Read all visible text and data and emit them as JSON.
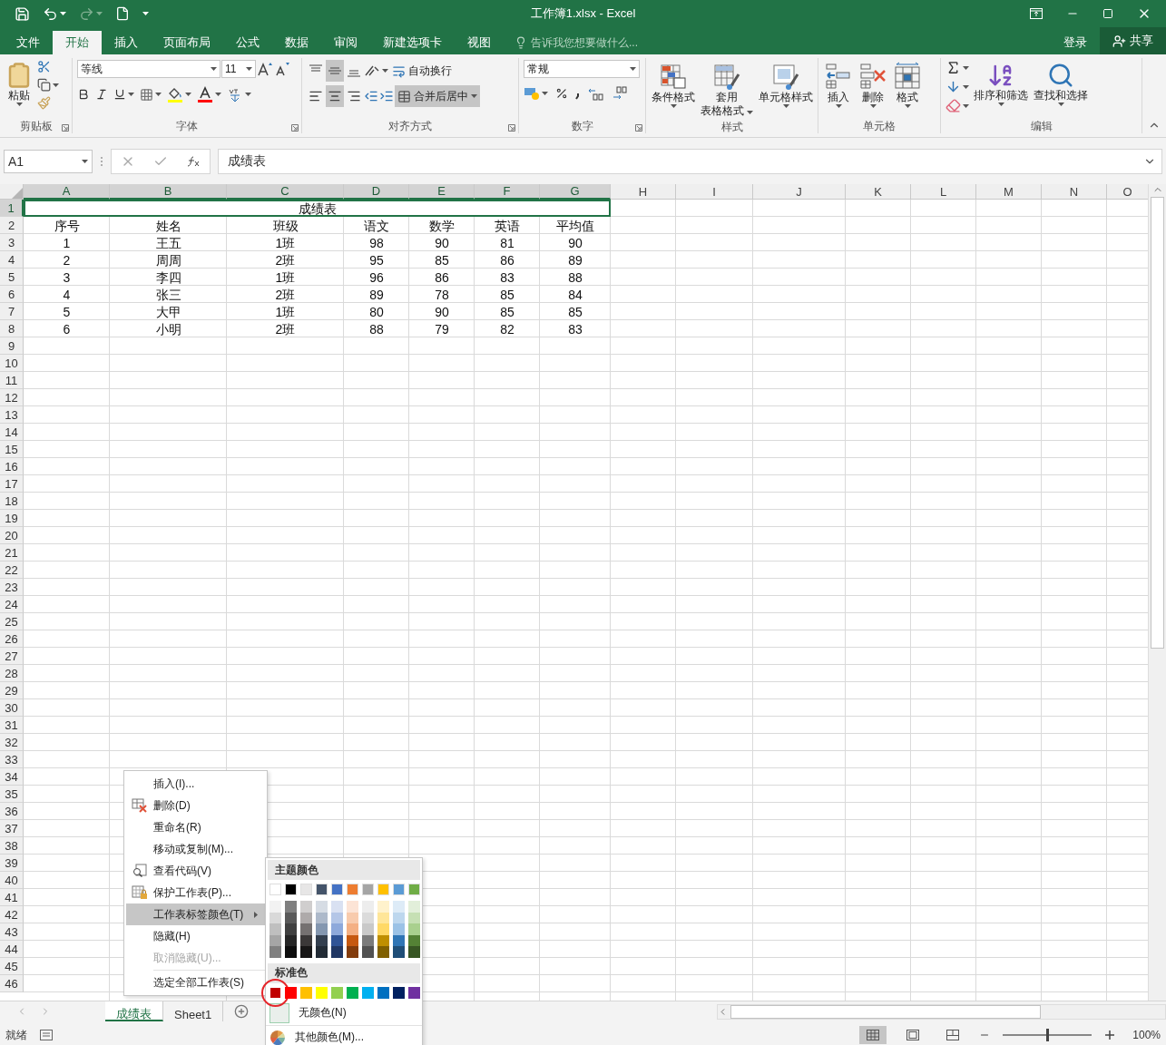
{
  "window": {
    "title": "工作簿1.xlsx - Excel"
  },
  "menu_tabs": [
    {
      "label": "文件",
      "selected": false
    },
    {
      "label": "开始",
      "selected": true
    },
    {
      "label": "插入",
      "selected": false
    },
    {
      "label": "页面布局",
      "selected": false
    },
    {
      "label": "公式",
      "selected": false
    },
    {
      "label": "数据",
      "selected": false
    },
    {
      "label": "审阅",
      "selected": false
    },
    {
      "label": "新建选项卡",
      "selected": false
    },
    {
      "label": "视图",
      "selected": false
    }
  ],
  "tell_me": {
    "placeholder": "告诉我您想要做什么..."
  },
  "account": {
    "login": "登录",
    "share": "共享"
  },
  "ribbon": {
    "clipboard": {
      "label": "剪贴板",
      "paste": "粘贴"
    },
    "font": {
      "label": "字体",
      "font_name": "等线",
      "font_size": "11"
    },
    "alignment": {
      "label": "对齐方式",
      "vertical": [
        {
          "selected": false
        },
        {
          "selected": true
        },
        {
          "selected": false
        }
      ],
      "horizontal": [
        {
          "selected": false
        },
        {
          "selected": true
        },
        {
          "selected": false
        }
      ],
      "wrap_text": "自动换行",
      "merge": {
        "label": "合并后居中",
        "selected": true
      }
    },
    "number": {
      "label": "数字",
      "format": "常规"
    },
    "styles": {
      "label": "样式",
      "buttons": [
        {
          "kind": "conditional",
          "lines": [
            "条件格式"
          ]
        },
        {
          "kind": "table",
          "lines": [
            "套用",
            "表格格式"
          ]
        },
        {
          "kind": "cellstyle",
          "lines": [
            "单元格样式"
          ]
        }
      ]
    },
    "cells": {
      "label": "单元格",
      "buttons": [
        {
          "kind": "insert",
          "lines": [
            "插入"
          ]
        },
        {
          "kind": "delete",
          "lines": [
            "删除"
          ]
        },
        {
          "kind": "format",
          "lines": [
            "格式"
          ]
        }
      ]
    },
    "editing": {
      "label": "编辑",
      "buttons": [
        {
          "kind": "sort",
          "lines": [
            "排序和筛选"
          ]
        },
        {
          "kind": "find",
          "lines": [
            "查找和选择"
          ]
        }
      ]
    }
  },
  "formula_bar": {
    "name_box": "A1",
    "formula": "成绩表"
  },
  "sheet": {
    "columns": [
      {
        "label": "A",
        "selected": true
      },
      {
        "label": "B",
        "selected": true
      },
      {
        "label": "C",
        "selected": true
      },
      {
        "label": "D",
        "selected": true
      },
      {
        "label": "E",
        "selected": true
      },
      {
        "label": "F",
        "selected": true
      },
      {
        "label": "G",
        "selected": true
      },
      {
        "label": "H",
        "selected": false
      },
      {
        "label": "I",
        "selected": false
      },
      {
        "label": "J",
        "selected": false
      },
      {
        "label": "K",
        "selected": false
      },
      {
        "label": "L",
        "selected": false
      },
      {
        "label": "M",
        "selected": false
      },
      {
        "label": "N",
        "selected": false
      },
      {
        "label": "O",
        "selected": false
      }
    ],
    "rows": [
      {
        "number": "1",
        "selected": true,
        "kind": "merged",
        "cells": [
          "成绩表"
        ]
      },
      {
        "number": "2",
        "selected": false,
        "kind": "data",
        "cells": [
          "序号",
          "姓名",
          "班级",
          "语文",
          "数学",
          "英语",
          "平均值"
        ]
      },
      {
        "number": "3",
        "selected": false,
        "kind": "data",
        "cells": [
          "1",
          "王五",
          "1班",
          "98",
          "90",
          "81",
          "90"
        ]
      },
      {
        "number": "4",
        "selected": false,
        "kind": "data",
        "cells": [
          "2",
          "周周",
          "2班",
          "95",
          "85",
          "86",
          "89"
        ]
      },
      {
        "number": "5",
        "selected": false,
        "kind": "data",
        "cells": [
          "3",
          "李四",
          "1班",
          "96",
          "86",
          "83",
          "88"
        ]
      },
      {
        "number": "6",
        "selected": false,
        "kind": "data",
        "cells": [
          "4",
          "张三",
          "2班",
          "89",
          "78",
          "85",
          "84"
        ]
      },
      {
        "number": "7",
        "selected": false,
        "kind": "data",
        "cells": [
          "5",
          "大甲",
          "1班",
          "80",
          "90",
          "85",
          "85"
        ]
      },
      {
        "number": "8",
        "selected": false,
        "kind": "data",
        "cells": [
          "6",
          "小明",
          "2班",
          "88",
          "79",
          "82",
          "83"
        ]
      },
      {
        "number": "9",
        "selected": false,
        "kind": "empty"
      },
      {
        "number": "10",
        "selected": false,
        "kind": "empty"
      },
      {
        "number": "11",
        "selected": false,
        "kind": "empty"
      },
      {
        "number": "12",
        "selected": false,
        "kind": "empty"
      },
      {
        "number": "13",
        "selected": false,
        "kind": "empty"
      },
      {
        "number": "14",
        "selected": false,
        "kind": "empty"
      },
      {
        "number": "15",
        "selected": false,
        "kind": "empty"
      },
      {
        "number": "16",
        "selected": false,
        "kind": "empty"
      },
      {
        "number": "17",
        "selected": false,
        "kind": "empty"
      },
      {
        "number": "18",
        "selected": false,
        "kind": "empty"
      },
      {
        "number": "19",
        "selected": false,
        "kind": "empty"
      },
      {
        "number": "20",
        "selected": false,
        "kind": "empty"
      },
      {
        "number": "21",
        "selected": false,
        "kind": "empty"
      },
      {
        "number": "22",
        "selected": false,
        "kind": "empty"
      },
      {
        "number": "23",
        "selected": false,
        "kind": "empty"
      },
      {
        "number": "24",
        "selected": false,
        "kind": "empty"
      },
      {
        "number": "25",
        "selected": false,
        "kind": "empty"
      },
      {
        "number": "26",
        "selected": false,
        "kind": "empty"
      },
      {
        "number": "27",
        "selected": false,
        "kind": "empty"
      },
      {
        "number": "28",
        "selected": false,
        "kind": "empty"
      },
      {
        "number": "29",
        "selected": false,
        "kind": "empty"
      },
      {
        "number": "30",
        "selected": false,
        "kind": "empty"
      },
      {
        "number": "31",
        "selected": false,
        "kind": "empty"
      },
      {
        "number": "32",
        "selected": false,
        "kind": "empty"
      },
      {
        "number": "33",
        "selected": false,
        "kind": "empty"
      },
      {
        "number": "34",
        "selected": false,
        "kind": "empty"
      },
      {
        "number": "35",
        "selected": false,
        "kind": "empty"
      },
      {
        "number": "36",
        "selected": false,
        "kind": "empty"
      },
      {
        "number": "37",
        "selected": false,
        "kind": "empty"
      },
      {
        "number": "38",
        "selected": false,
        "kind": "empty"
      },
      {
        "number": "39",
        "selected": false,
        "kind": "empty"
      },
      {
        "number": "40",
        "selected": false,
        "kind": "empty"
      },
      {
        "number": "41",
        "selected": false,
        "kind": "empty"
      },
      {
        "number": "42",
        "selected": false,
        "kind": "empty"
      },
      {
        "number": "43",
        "selected": false,
        "kind": "empty"
      },
      {
        "number": "44",
        "selected": false,
        "kind": "empty"
      },
      {
        "number": "45",
        "selected": false,
        "kind": "empty"
      },
      {
        "number": "46",
        "selected": false,
        "kind": "empty"
      }
    ]
  },
  "sheet_tabs": [
    {
      "label": "成绩表",
      "selected": true
    },
    {
      "label": "Sheet1",
      "selected": false
    }
  ],
  "status_bar": {
    "status": "就绪",
    "views": [
      {
        "kind": "normal",
        "selected": true
      },
      {
        "kind": "layout",
        "selected": false
      },
      {
        "kind": "pagebreak",
        "selected": false
      }
    ],
    "zoom": {
      "level": 0.5,
      "reading": "100%"
    }
  },
  "context_menu": {
    "items": [
      {
        "kind": "plain",
        "label": "插入(I)...",
        "disabled": false,
        "selected": false,
        "separator_before": false
      },
      {
        "kind": "delete",
        "label": "删除(D)",
        "disabled": false,
        "selected": false,
        "separator_before": false
      },
      {
        "kind": "plain",
        "label": "重命名(R)",
        "disabled": false,
        "selected": false,
        "separator_before": false
      },
      {
        "kind": "plain",
        "label": "移动或复制(M)...",
        "disabled": false,
        "selected": false,
        "separator_before": false
      },
      {
        "kind": "code",
        "label": "查看代码(V)",
        "disabled": false,
        "selected": false,
        "separator_before": false
      },
      {
        "kind": "protect",
        "label": "保护工作表(P)...",
        "disabled": false,
        "selected": false,
        "separator_before": false
      },
      {
        "kind": "submenu",
        "label": "工作表标签颜色(T)",
        "disabled": false,
        "selected": true,
        "separator_before": false
      },
      {
        "kind": "plain",
        "label": "隐藏(H)",
        "disabled": false,
        "selected": false,
        "separator_before": false
      },
      {
        "kind": "plain",
        "label": "取消隐藏(U)...",
        "disabled": true,
        "selected": false,
        "separator_before": false
      },
      {
        "kind": "plain",
        "label": "选定全部工作表(S)",
        "disabled": false,
        "selected": false,
        "separator_before": true
      }
    ]
  },
  "tab_color_menu": {
    "theme_title": "主题颜色",
    "theme_colors": [
      {
        "color": "#ffffff",
        "shades": [
          {
            "color": "#f2f2f2"
          },
          {
            "color": "#d9d9d9"
          },
          {
            "color": "#bfbfbf"
          },
          {
            "color": "#a6a6a6"
          },
          {
            "color": "#808080"
          }
        ]
      },
      {
        "color": "#000000",
        "shades": [
          {
            "color": "#7f7f7f"
          },
          {
            "color": "#595959"
          },
          {
            "color": "#404040"
          },
          {
            "color": "#262626"
          },
          {
            "color": "#0d0d0d"
          }
        ]
      },
      {
        "color": "#e7e6e6",
        "shades": [
          {
            "color": "#d0cece"
          },
          {
            "color": "#aeaaaa"
          },
          {
            "color": "#757171"
          },
          {
            "color": "#3b3838"
          },
          {
            "color": "#171616"
          }
        ]
      },
      {
        "color": "#44546a",
        "shades": [
          {
            "color": "#d6dce4"
          },
          {
            "color": "#adb9ca"
          },
          {
            "color": "#8497b0"
          },
          {
            "color": "#333f4f"
          },
          {
            "color": "#222b35"
          }
        ]
      },
      {
        "color": "#4472c4",
        "shades": [
          {
            "color": "#d9e1f2"
          },
          {
            "color": "#b4c6e7"
          },
          {
            "color": "#8ea9db"
          },
          {
            "color": "#305496"
          },
          {
            "color": "#203764"
          }
        ]
      },
      {
        "color": "#ed7d31",
        "shades": [
          {
            "color": "#fce4d6"
          },
          {
            "color": "#f8cbad"
          },
          {
            "color": "#f4b084"
          },
          {
            "color": "#c65911"
          },
          {
            "color": "#833c0c"
          }
        ]
      },
      {
        "color": "#a5a5a5",
        "shades": [
          {
            "color": "#ededed"
          },
          {
            "color": "#dbdbdb"
          },
          {
            "color": "#c9c9c9"
          },
          {
            "color": "#7b7b7b"
          },
          {
            "color": "#525252"
          }
        ]
      },
      {
        "color": "#ffc000",
        "shades": [
          {
            "color": "#fff2cc"
          },
          {
            "color": "#ffe699"
          },
          {
            "color": "#ffd966"
          },
          {
            "color": "#bf8f00"
          },
          {
            "color": "#806000"
          }
        ]
      },
      {
        "color": "#5b9bd5",
        "shades": [
          {
            "color": "#ddebf7"
          },
          {
            "color": "#bdd7ee"
          },
          {
            "color": "#9bc2e6"
          },
          {
            "color": "#2f75b5"
          },
          {
            "color": "#1f4e78"
          }
        ]
      },
      {
        "color": "#70ad47",
        "shades": [
          {
            "color": "#e2efda"
          },
          {
            "color": "#c6e0b4"
          },
          {
            "color": "#a9d08e"
          },
          {
            "color": "#548235"
          },
          {
            "color": "#375623"
          }
        ]
      }
    ],
    "standard_title": "标准色",
    "standard_colors": [
      {
        "color": "#c00000",
        "selected": true
      },
      {
        "color": "#ff0000",
        "selected": false
      },
      {
        "color": "#ffc000",
        "selected": false
      },
      {
        "color": "#ffff00",
        "selected": false
      },
      {
        "color": "#92d050",
        "selected": false
      },
      {
        "color": "#00b050",
        "selected": false
      },
      {
        "color": "#00b0f0",
        "selected": false
      },
      {
        "color": "#0070c0",
        "selected": false
      },
      {
        "color": "#002060",
        "selected": false
      },
      {
        "color": "#7030a0",
        "selected": false
      }
    ],
    "no_color": "无颜色(N)",
    "more_colors": "其他颜色(M)..."
  }
}
